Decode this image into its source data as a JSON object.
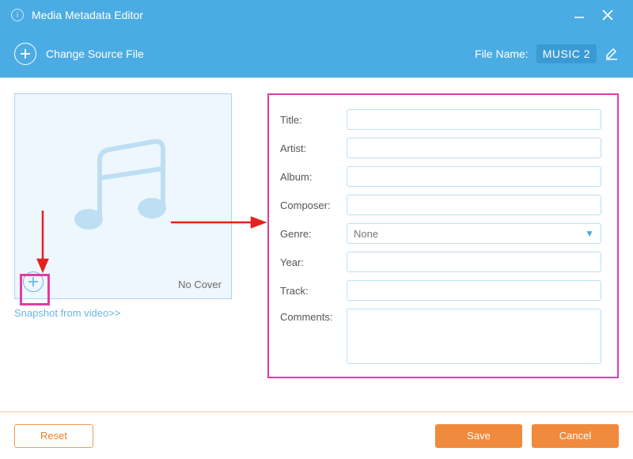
{
  "window": {
    "title": "Media Metadata Editor"
  },
  "toolbar": {
    "change_source": "Change Source File",
    "file_name_label": "File Name:",
    "file_name_value": "MUSIC 2"
  },
  "cover": {
    "no_cover": "No Cover",
    "snapshot_link": "Snapshot from video>>"
  },
  "form": {
    "title_label": "Title:",
    "artist_label": "Artist:",
    "album_label": "Album:",
    "composer_label": "Composer:",
    "genre_label": "Genre:",
    "genre_value": "None",
    "year_label": "Year:",
    "track_label": "Track:",
    "comments_label": "Comments:"
  },
  "footer": {
    "reset": "Reset",
    "save": "Save",
    "cancel": "Cancel"
  }
}
